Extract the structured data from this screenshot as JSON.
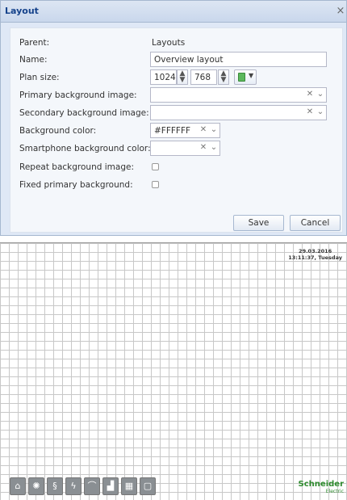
{
  "dialog": {
    "title": "Layout",
    "close_glyph": "×",
    "rows": {
      "parent": {
        "label": "Parent:",
        "value": "Layouts"
      },
      "name": {
        "label": "Name:",
        "value": "Overview layout"
      },
      "plan_size": {
        "label": "Plan size:",
        "width": "1024",
        "height": "768"
      },
      "primary_bg": {
        "label": "Primary background image:",
        "value": ""
      },
      "secondary_bg": {
        "label": "Secondary background image:",
        "value": ""
      },
      "bg_color": {
        "label": "Background color:",
        "value": "#FFFFFF"
      },
      "smartphone_bg_color": {
        "label": "Smartphone background color:",
        "value": ""
      },
      "repeat_bg": {
        "label": "Repeat background image:",
        "checked": false
      },
      "fixed_primary_bg": {
        "label": "Fixed primary background:",
        "checked": false
      }
    },
    "buttons": {
      "save": "Save",
      "cancel": "Cancel"
    }
  },
  "plan": {
    "date": "29.03.2016",
    "time": "13:11:37, Tuesday",
    "toolbar_icons": [
      "home-icon",
      "light-icon",
      "blinds-icon",
      "energy-icon",
      "shade-icon",
      "chart-icon",
      "calendar-icon",
      "document-icon"
    ],
    "logo": {
      "main": "Schneider",
      "sub": "Electric"
    }
  },
  "colors": {
    "dialog_bg": "#dfe8f6",
    "title_text": "#15428b",
    "logo_green": "#2e8b2e",
    "grid_line": "#c8c8c8"
  }
}
